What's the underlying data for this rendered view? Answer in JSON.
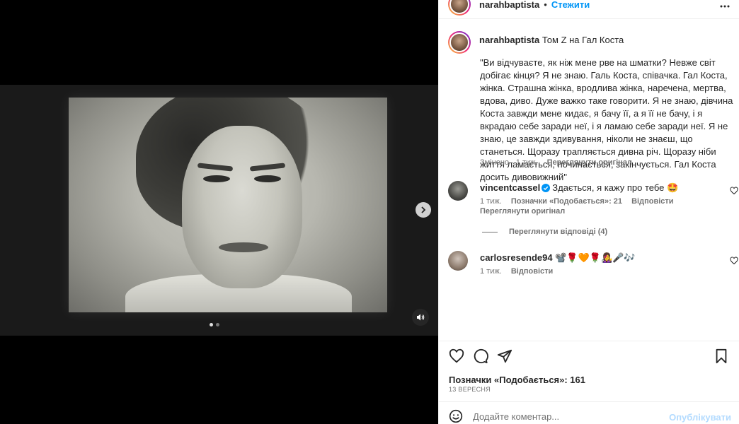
{
  "header": {
    "username": "narahbaptista",
    "separator": "•",
    "follow_label": "Стежити"
  },
  "caption": {
    "username": "narahbaptista",
    "title": "Том Z на Гал Коста",
    "body": "\"Ви відчуваєте, як ніж мене рве на шматки? Невже світ добігає кінця? Я не знаю. Галь Коста, співачка. Гал Коста, жінка. Страшна жінка, вродлива жінка, наречена, мертва, вдова, диво. Дуже важко таке говорити. Я не знаю, дівчина Коста завжди мене кидає, я бачу її, а я її не бачу, і я вкрадаю себе заради неї, і я ламаю себе заради неї. Я не знаю, це завжди здивування, ніколи не знаєш, що станеться. Щоразу трапляється дивна річ. Щоразу ніби життя ламається, починається, закінчується. Гал Коста досить дивовижний\"",
    "edited_time": "Змінено · 1 тиж.",
    "see_translation": "Переглянути оригінал"
  },
  "comments": [
    {
      "username": "vincentcassel",
      "text": "Здається, я кажу про тебе 🤩",
      "time": "1 тиж.",
      "likes": "Позначки «Подобається»: 21",
      "reply": "Відповісти",
      "see_translation": "Переглянути оригінал",
      "view_replies": "Переглянути відповіді (4)"
    },
    {
      "username": "carlosresende94",
      "text": "📽️🌹🧡🌹👩‍🎤🎤🎶",
      "time": "1 тиж.",
      "reply": "Відповісти"
    }
  ],
  "post": {
    "likes": "Позначки «Подобається»: 161",
    "date": "13 ВЕРЕСНЯ"
  },
  "add_comment": {
    "placeholder": "Додайте коментар...",
    "publish_label": "Опублікувати"
  },
  "icons": {
    "header_more": "more-horizontal-icon",
    "next": "chevron-right-icon",
    "sound": "speaker-icon",
    "like": "heart-icon",
    "comment": "comment-bubble-icon",
    "share": "paper-plane-icon",
    "save": "bookmark-icon",
    "emoji": "emoji-smile-icon",
    "verified": "verified-badge-icon"
  },
  "colors": {
    "accent": "#0095f6",
    "muted": "#737373",
    "publish_disabled": "#b3dbff",
    "text": "#262626"
  },
  "carousel": {
    "current": 1,
    "total": 2
  }
}
